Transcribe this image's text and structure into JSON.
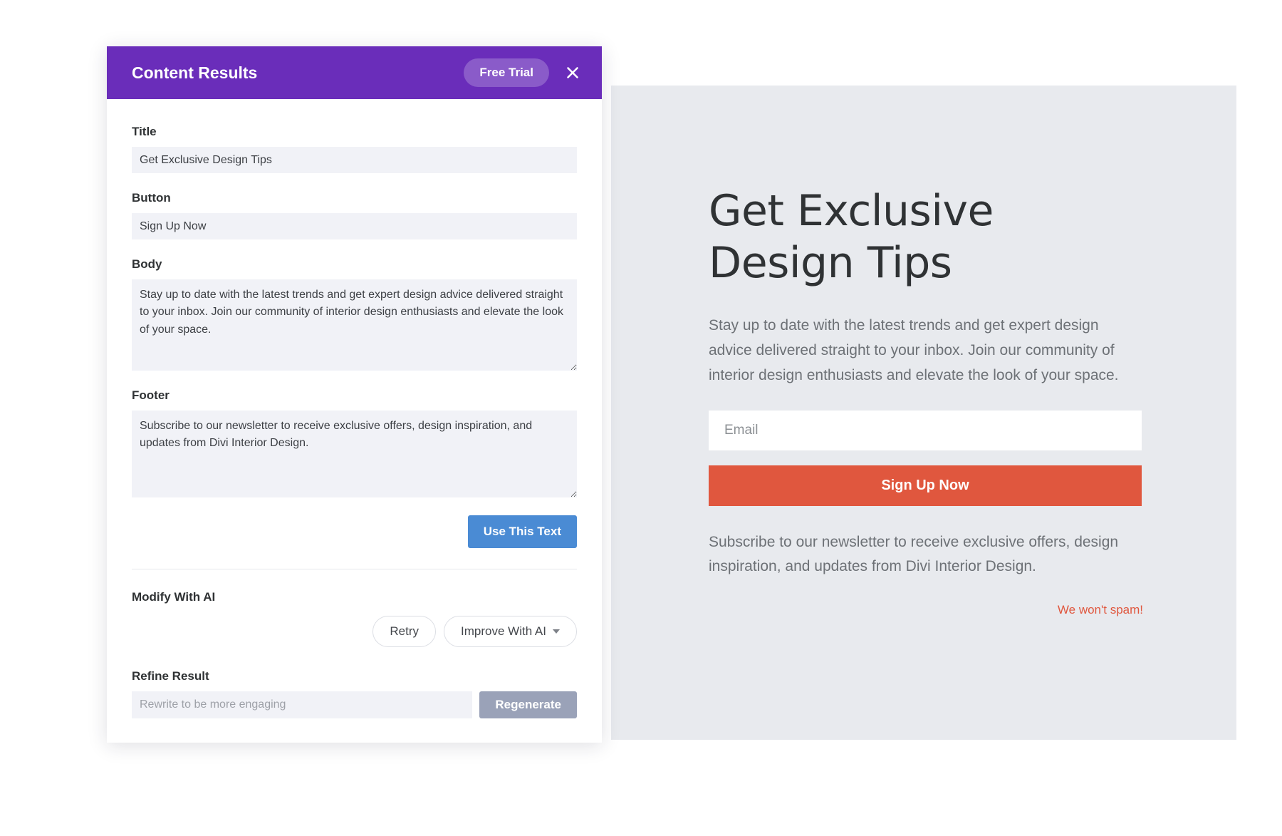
{
  "modal": {
    "title": "Content Results",
    "free_trial_label": "Free Trial",
    "close_icon": "close-icon",
    "accent_color": "#6a2dba",
    "fields": {
      "title_label": "Title",
      "title_value": "Get Exclusive Design Tips",
      "button_label": "Button",
      "button_value": "Sign Up Now",
      "body_label": "Body",
      "body_value": "Stay up to date with the latest trends and get expert design advice delivered straight to your inbox. Join our community of interior design enthusiasts and elevate the look of your space.",
      "footer_label": "Footer",
      "footer_value": "Subscribe to our newsletter to receive exclusive offers, design inspiration, and updates from Divi Interior Design."
    },
    "use_this_text_label": "Use This Text",
    "use_this_text_color": "#4a8bd4",
    "modify_with_ai_label": "Modify With AI",
    "retry_label": "Retry",
    "improve_with_ai_label": "Improve With AI",
    "improve_with_ai_icon": "chevron-down-icon",
    "refine_result_label": "Refine Result",
    "refine_placeholder": "Rewrite to be more engaging",
    "refine_value": "",
    "regenerate_label": "Regenerate",
    "regenerate_color": "#9aa2b8"
  },
  "preview": {
    "headline": "Get Exclusive Design Tips",
    "body": "Stay up to date with the latest trends and get expert design advice delivered straight to your inbox. Join our community of interior design enthusiasts and elevate the look of your space.",
    "email_placeholder": "Email",
    "email_value": "",
    "cta_label": "Sign Up Now",
    "cta_color": "#e0573e",
    "footer": "Subscribe to our newsletter to receive exclusive offers, design inspiration, and updates from Divi Interior Design.",
    "spam_note": "We won't spam!",
    "spam_note_color": "#e0573e",
    "background_color": "#e8eaee"
  }
}
